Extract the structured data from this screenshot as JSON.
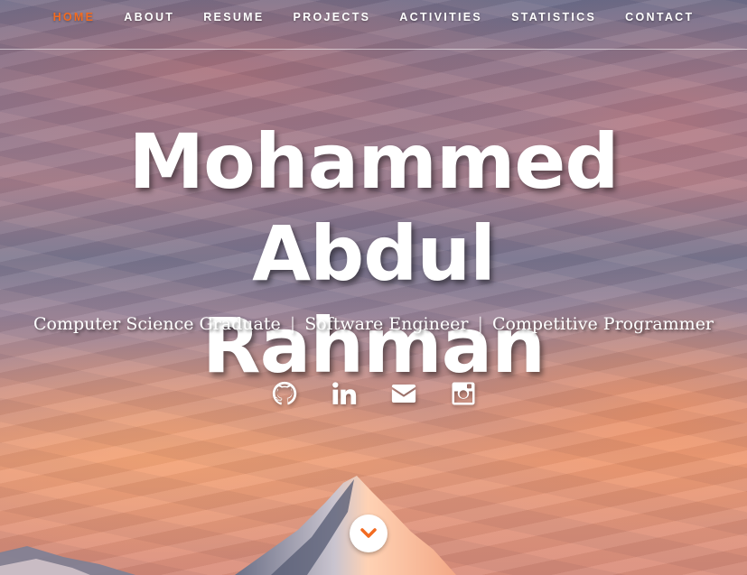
{
  "nav": {
    "items": [
      {
        "label": "HOME",
        "active": true
      },
      {
        "label": "ABOUT",
        "active": false
      },
      {
        "label": "RESUME",
        "active": false
      },
      {
        "label": "PROJECTS",
        "active": false
      },
      {
        "label": "ACTIVITIES",
        "active": false
      },
      {
        "label": "STATISTICS",
        "active": false
      },
      {
        "label": "CONTACT",
        "active": false
      }
    ],
    "active_color": "#f26b21"
  },
  "hero": {
    "name_line1": "Mohammed Abdul",
    "name_line2": "Rahman",
    "subtitle": {
      "roles": [
        "Computer Science Graduate",
        "Software Engineer",
        "Competitive Programmer"
      ],
      "separator": "|"
    }
  },
  "social": [
    {
      "icon": "github-icon"
    },
    {
      "icon": "linkedin-icon"
    },
    {
      "icon": "envelope-icon"
    },
    {
      "icon": "instagram-icon"
    }
  ],
  "scroll": {
    "icon": "chevron-down-icon",
    "accent": "#f26b21"
  }
}
